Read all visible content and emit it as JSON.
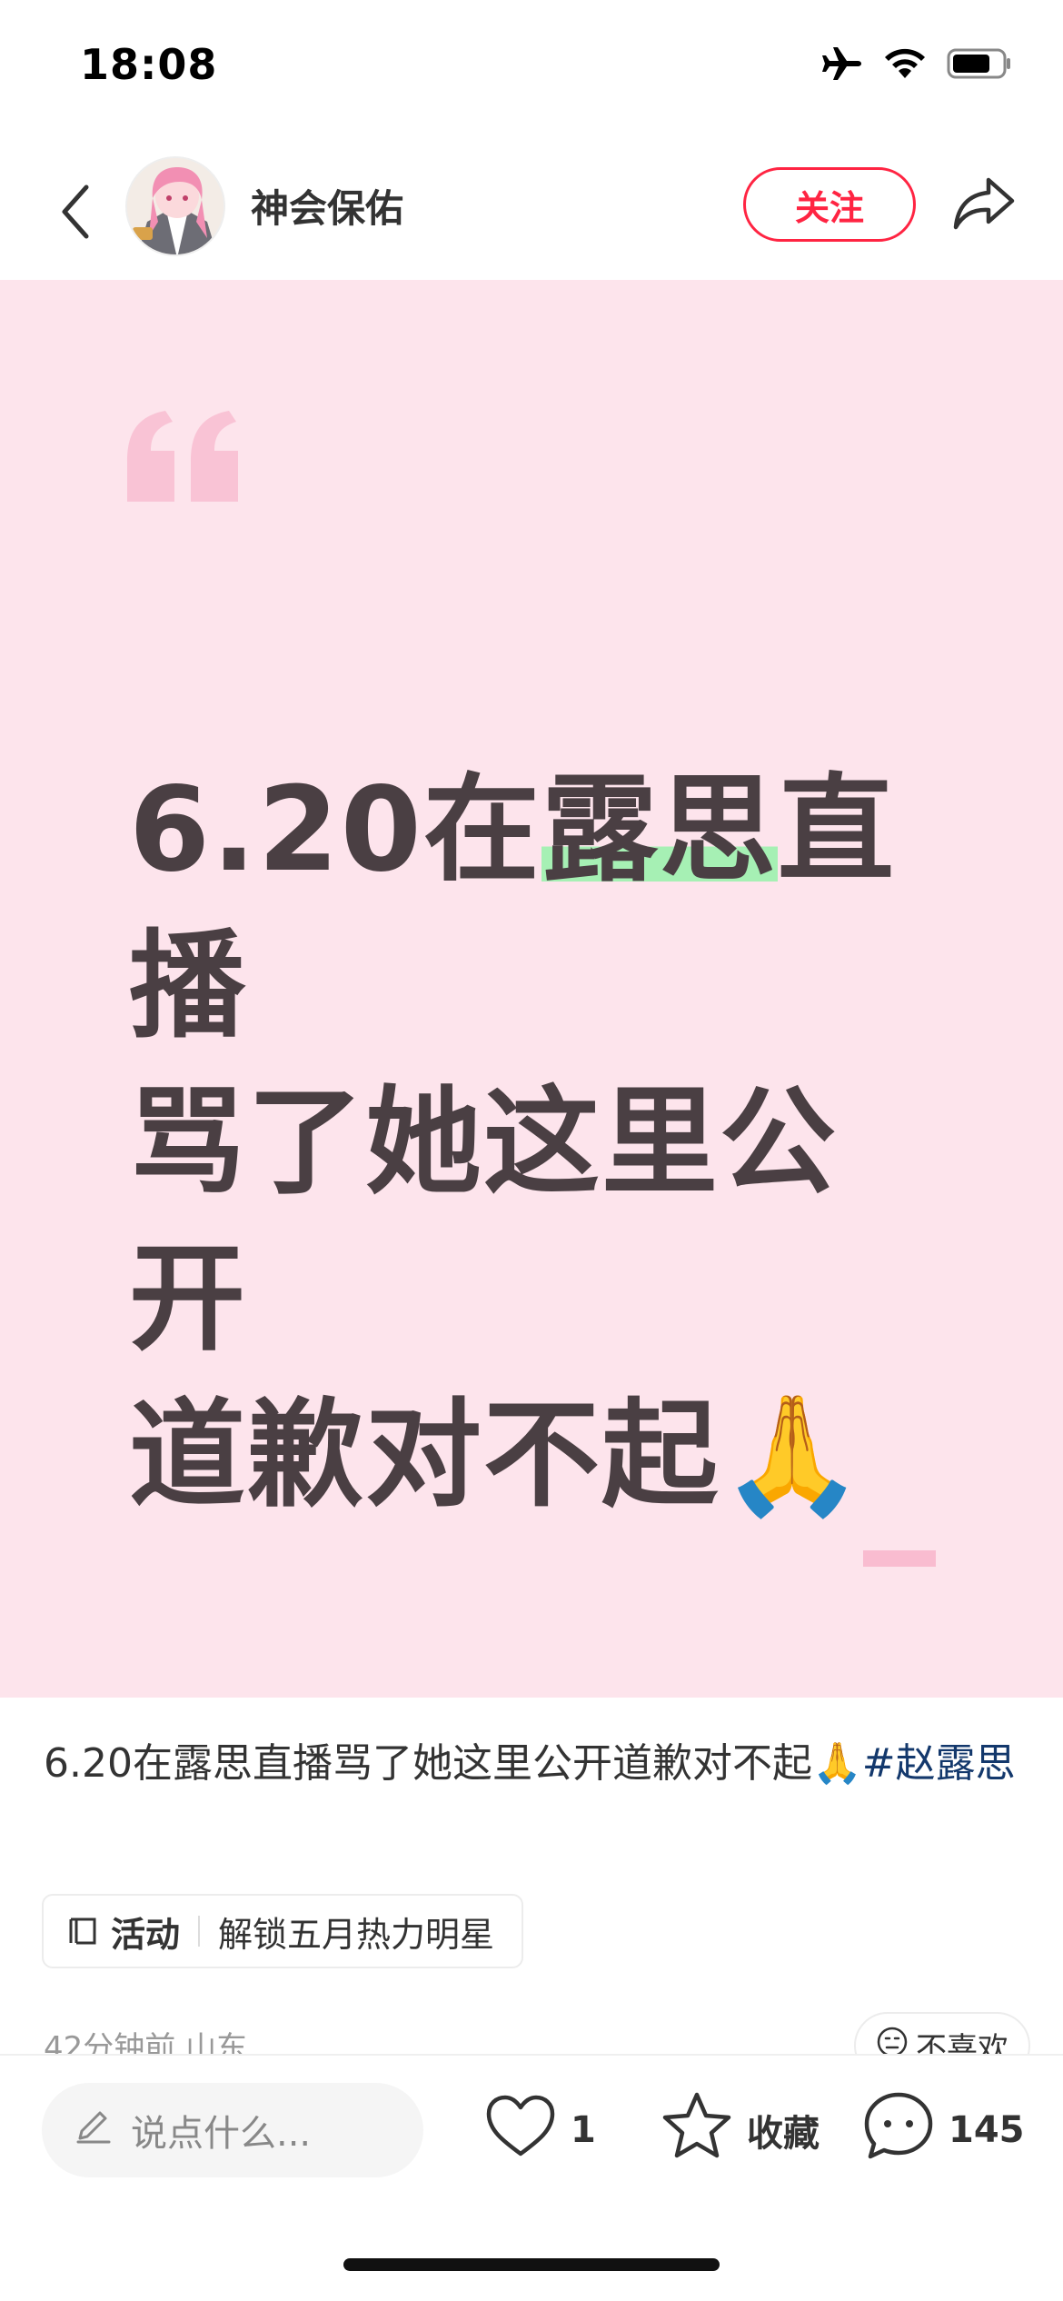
{
  "status_bar": {
    "time": "18:08",
    "icons": [
      "airplane-icon",
      "wifi-icon",
      "battery-icon"
    ]
  },
  "header": {
    "back_icon": "chevron-left-icon",
    "username": "神会保佑",
    "follow_label": "关注",
    "share_icon": "share-icon"
  },
  "card": {
    "background_color": "#fde4ec",
    "lines": [
      {
        "before": "6.20在",
        "highlight": "露思",
        "after": "直播"
      },
      {
        "before": "骂了她这里公开",
        "highlight": "",
        "after": ""
      },
      {
        "before": "道歉对不起🙏",
        "highlight": "",
        "after": ""
      }
    ]
  },
  "caption": {
    "text": "6.20在露思直播骂了她这里公开道歉对不起🙏",
    "hashtag": "#赵露思"
  },
  "activity": {
    "label": "活动",
    "description": "解锁五月热力明星"
  },
  "meta": {
    "time_location": "42分钟前 山东",
    "dislike_label": "不喜欢"
  },
  "bottom_bar": {
    "comment_placeholder": "说点什么...",
    "like_count": "1",
    "favorite_label": "收藏",
    "comment_count": "145"
  },
  "colors": {
    "accent": "#ff2442",
    "hashtag": "#13386c",
    "card_text": "#4a3f43",
    "highlight": "#a6f0b4"
  }
}
